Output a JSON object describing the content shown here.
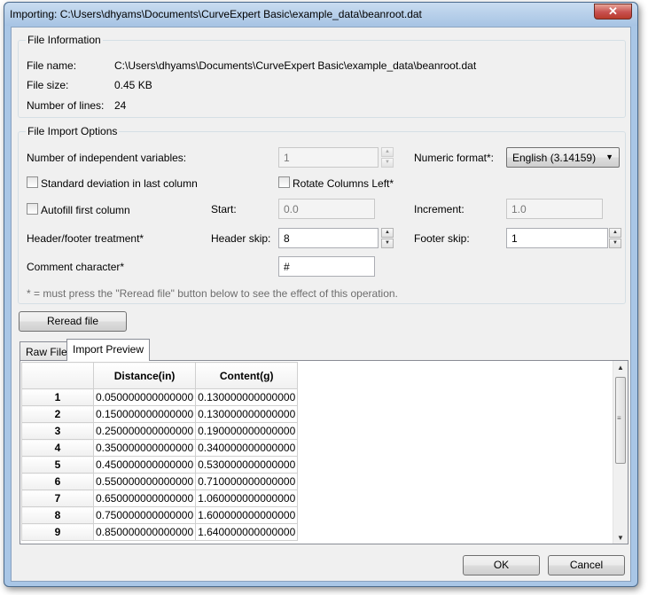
{
  "window": {
    "title": "Importing: C:\\Users\\dhyams\\Documents\\CurveExpert Basic\\example_data\\beanroot.dat",
    "close_glyph": "✕"
  },
  "file_info": {
    "group_title": "File Information",
    "name_label": "File name:",
    "name_value": "C:\\Users\\dhyams\\Documents\\CurveExpert Basic\\example_data\\beanroot.dat",
    "size_label": "File size:",
    "size_value": "0.45 KB",
    "lines_label": "Number of lines:",
    "lines_value": "24"
  },
  "import_options": {
    "group_title": "File Import Options",
    "indep_label": "Number of independent variables:",
    "indep_value": "1",
    "numeric_format_label": "Numeric format*:",
    "numeric_format_value": "English (3.14159)",
    "std_dev_label": "Standard deviation in last column",
    "rotate_label": "Rotate Columns Left*",
    "autofill_label": "Autofill first column",
    "start_label": "Start:",
    "start_value": "0.0",
    "increment_label": "Increment:",
    "increment_value": "1.0",
    "header_footer_label": "Header/footer treatment*",
    "header_skip_label": "Header skip:",
    "header_skip_value": "8",
    "footer_skip_label": "Footer skip:",
    "footer_skip_value": "1",
    "comment_label": "Comment character*",
    "comment_value": "#",
    "note": "* = must press the \"Reread file\" button below to see the effect of this operation."
  },
  "reread_button": "Reread file",
  "tabs": [
    "Raw File",
    "Import Preview"
  ],
  "preview": {
    "columns": [
      "Distance(in)",
      "Content(g)"
    ],
    "rows": [
      {
        "n": "1",
        "a": "0.050000000000000",
        "b": "0.130000000000000"
      },
      {
        "n": "2",
        "a": "0.150000000000000",
        "b": "0.130000000000000"
      },
      {
        "n": "3",
        "a": "0.250000000000000",
        "b": "0.190000000000000"
      },
      {
        "n": "4",
        "a": "0.350000000000000",
        "b": "0.340000000000000"
      },
      {
        "n": "5",
        "a": "0.450000000000000",
        "b": "0.530000000000000"
      },
      {
        "n": "6",
        "a": "0.550000000000000",
        "b": "0.710000000000000"
      },
      {
        "n": "7",
        "a": "0.650000000000000",
        "b": "1.060000000000000"
      },
      {
        "n": "8",
        "a": "0.750000000000000",
        "b": "1.600000000000000"
      },
      {
        "n": "9",
        "a": "0.850000000000000",
        "b": "1.640000000000000"
      }
    ]
  },
  "buttons": {
    "ok": "OK",
    "cancel": "Cancel"
  }
}
